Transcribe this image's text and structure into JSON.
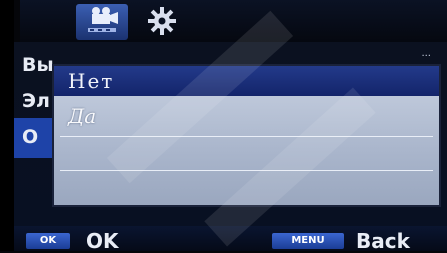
{
  "tabs": [
    {
      "icon": "video-camera-icon",
      "active": true
    },
    {
      "icon": "gear-icon",
      "active": false
    }
  ],
  "menu": {
    "items": [
      {
        "label": "Вы"
      },
      {
        "label": "Эл"
      },
      {
        "label": "О"
      }
    ],
    "value": "..."
  },
  "popup": {
    "options": [
      {
        "label": "Нет",
        "selected": true
      },
      {
        "label": "Да",
        "selected": false
      }
    ]
  },
  "footer": {
    "ok_key": "OK",
    "ok_label": "OK",
    "menu_key": "MENU",
    "back_label": "Back"
  },
  "colors": {
    "selection": "#1f3588",
    "popup_bg": "#b8c2d6",
    "key_bg": "#2a54c0"
  }
}
